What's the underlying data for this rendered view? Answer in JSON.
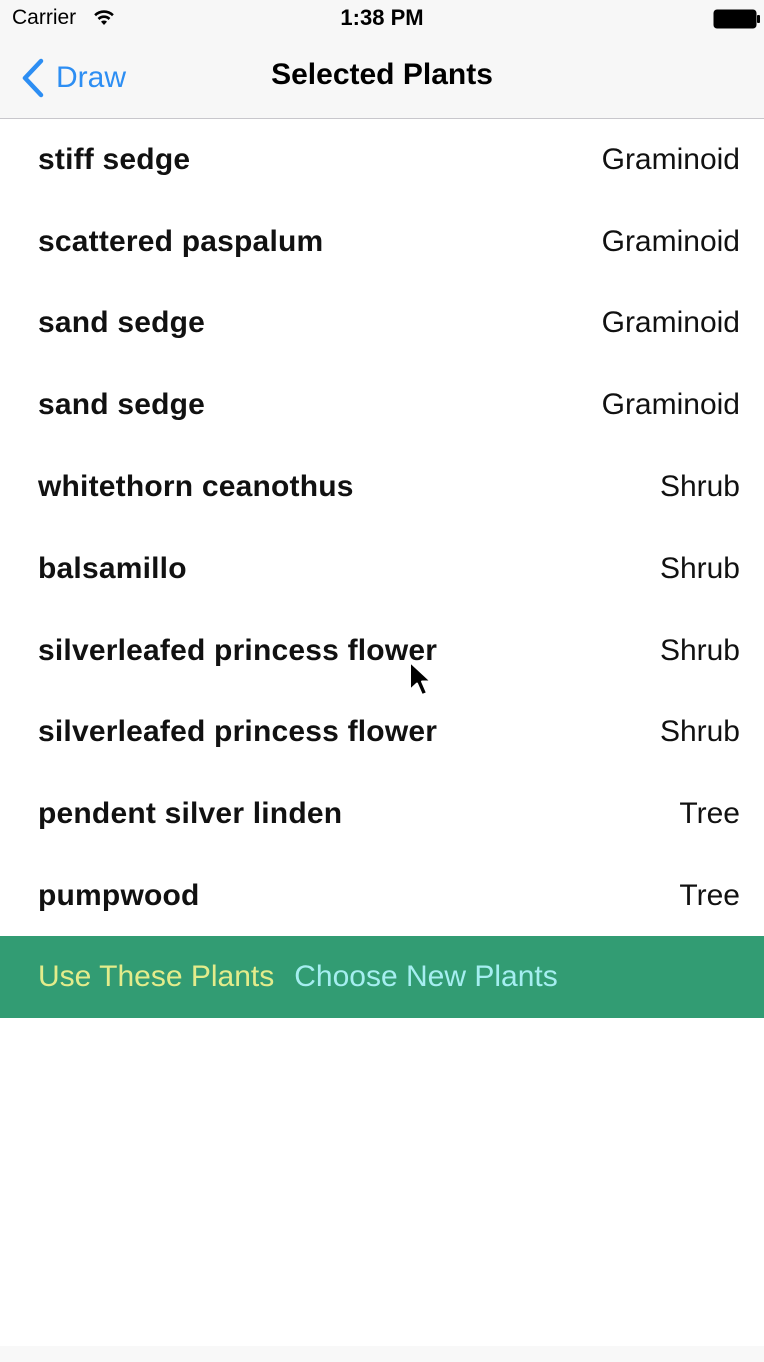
{
  "status_bar": {
    "carrier": "Carrier",
    "time": "1:38 PM"
  },
  "nav": {
    "back_label": "Draw",
    "title": "Selected Plants"
  },
  "plants": [
    {
      "name": "stiff sedge",
      "type": "Graminoid"
    },
    {
      "name": "scattered paspalum",
      "type": "Graminoid"
    },
    {
      "name": "sand sedge",
      "type": "Graminoid"
    },
    {
      "name": "sand sedge",
      "type": "Graminoid"
    },
    {
      "name": "whitethorn ceanothus",
      "type": "Shrub"
    },
    {
      "name": "balsamillo",
      "type": "Shrub"
    },
    {
      "name": "silverleafed princess flower",
      "type": "Shrub"
    },
    {
      "name": "silverleafed princess flower",
      "type": "Shrub"
    },
    {
      "name": "pendent silver linden",
      "type": "Tree"
    },
    {
      "name": "pumpwood",
      "type": "Tree"
    }
  ],
  "actions": {
    "use_label": "Use These Plants",
    "choose_label": "Choose New Plants"
  },
  "colors": {
    "accent_blue": "#2d8ef3",
    "action_bar_green": "#329c73",
    "use_label_color": "#e3ec8b",
    "choose_label_color": "#a5eef0"
  },
  "icons": {
    "wifi": "wifi-icon",
    "battery": "battery-icon",
    "back": "chevron-left-icon",
    "cursor": "mouse-pointer-icon"
  }
}
